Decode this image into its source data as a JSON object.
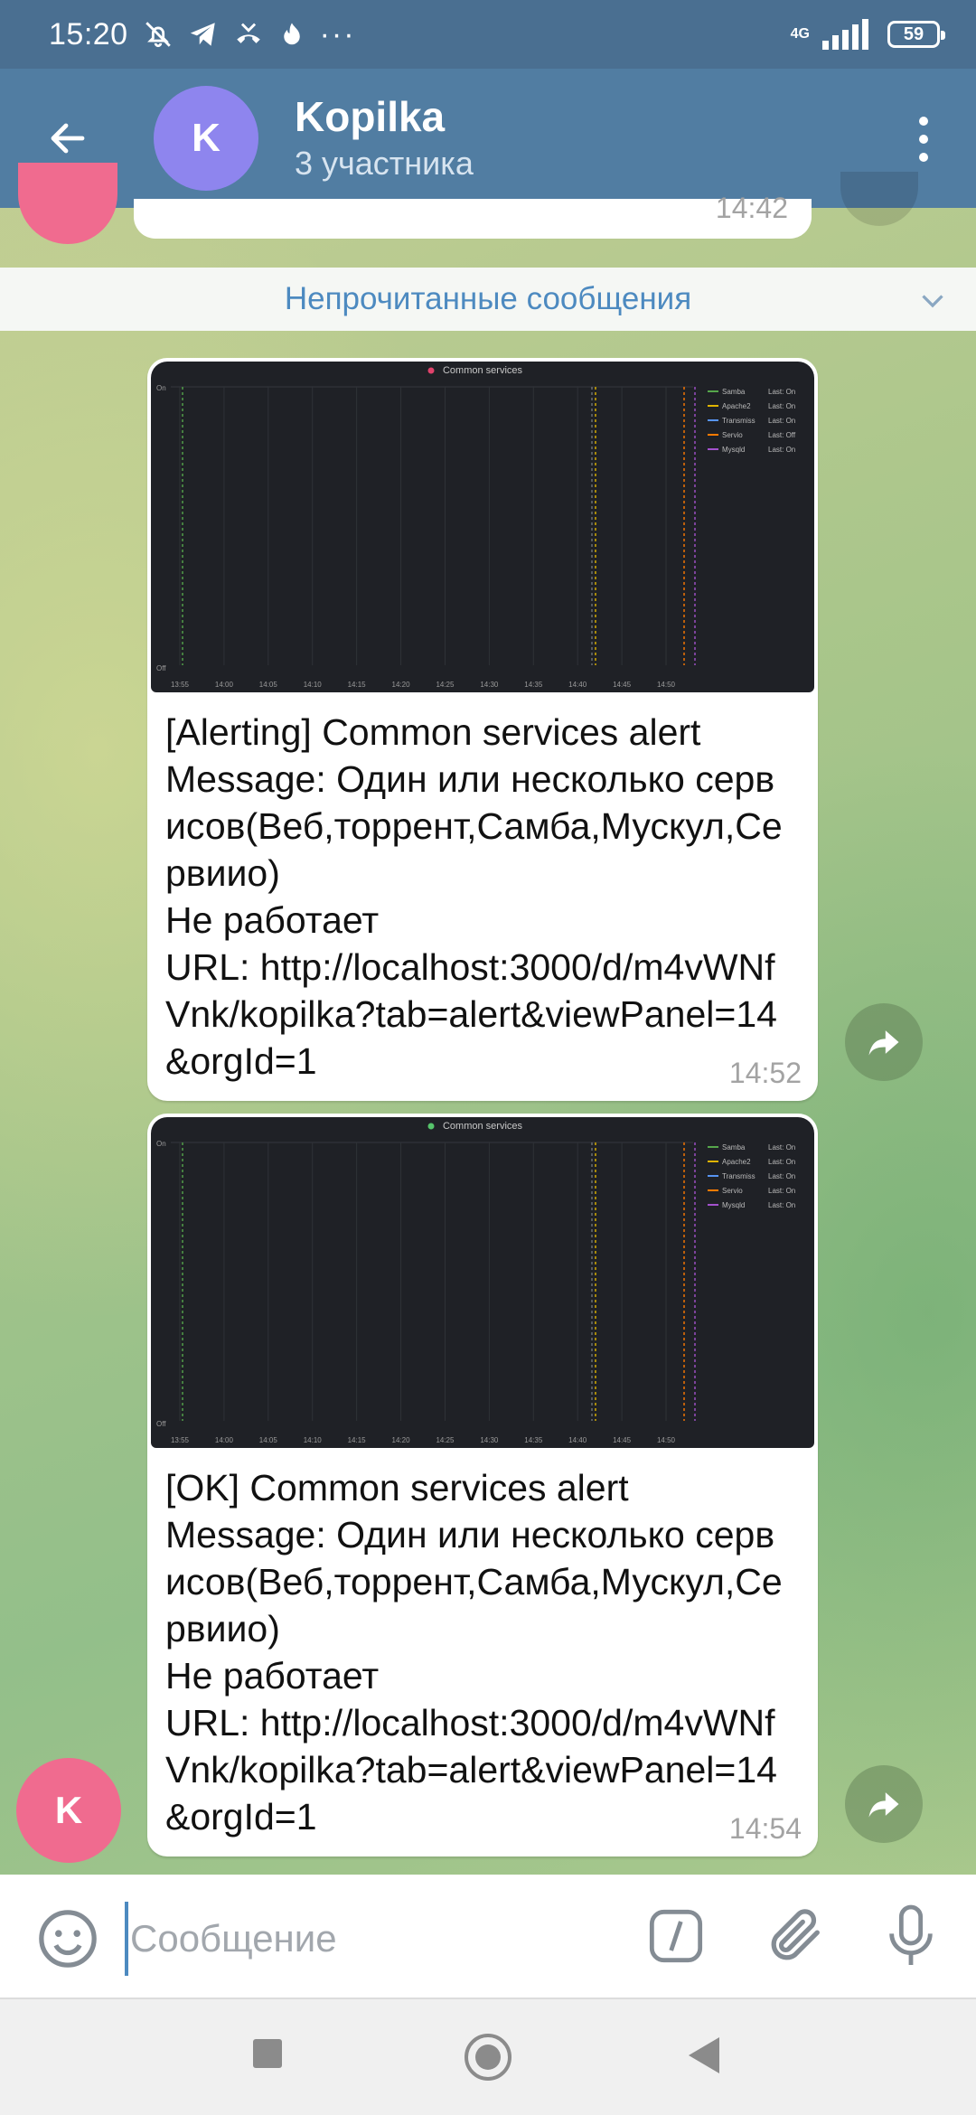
{
  "status_bar": {
    "time": "15:20",
    "network": "4G",
    "battery": "59"
  },
  "header": {
    "back_icon": "arrow-left-icon",
    "avatar_letter": "K",
    "title": "Kopilka",
    "subtitle": "3 участника",
    "menu_icon": "more-vertical-icon"
  },
  "previous_message": {
    "time": "14:42"
  },
  "unread_divider": {
    "label": "Непрочитанные сообщения"
  },
  "messages": [
    {
      "text": "[Alerting] Common services alert\nMessage: Один или несколько сервисов(Веб,торрент,Самба,Мускул,Сервиио)\nНе работает\nURL: http://localhost:3000/d/m4vWNfVnk/kopilka?tab=alert&viewPanel=14&orgId=1",
      "time": "14:52",
      "graph": {
        "title": "Common services",
        "heart_color": "#e0426b",
        "y_ticks": [
          "On",
          "Off"
        ],
        "x_ticks": [
          "13:55",
          "14:00",
          "14:05",
          "14:10",
          "14:15",
          "14:20",
          "14:25",
          "14:30",
          "14:35",
          "14:40",
          "14:45",
          "14:50"
        ],
        "legend": [
          {
            "name": "Samba",
            "value": "Last: On",
            "color": "#56a64b"
          },
          {
            "name": "Apache2",
            "value": "Last: On",
            "color": "#e0b400"
          },
          {
            "name": "Transmiss",
            "value": "Last: On",
            "color": "#5794f2"
          },
          {
            "name": "Servio",
            "value": "Last: Off",
            "color": "#ff7a00"
          },
          {
            "name": "Mysqld",
            "value": "Last: On",
            "color": "#a352cc"
          }
        ]
      }
    },
    {
      "text": "[OK] Common services alert\nMessage: Один или несколько сервисов(Веб,торрент,Самба,Мускул,Сервиио)\nНе работает\nURL: http://localhost:3000/d/m4vWNfVnk/kopilka?tab=alert&viewPanel=14&orgId=1",
      "time": "14:54",
      "sender_avatar_letter": "K",
      "graph": {
        "title": "Common services",
        "heart_color": "#56c46b",
        "y_ticks": [
          "On",
          "Off"
        ],
        "x_ticks": [
          "13:55",
          "14:00",
          "14:05",
          "14:10",
          "14:15",
          "14:20",
          "14:25",
          "14:30",
          "14:35",
          "14:40",
          "14:45",
          "14:50"
        ],
        "legend": [
          {
            "name": "Samba",
            "value": "Last: On",
            "color": "#56a64b"
          },
          {
            "name": "Apache2",
            "value": "Last: On",
            "color": "#e0b400"
          },
          {
            "name": "Transmiss",
            "value": "Last: On",
            "color": "#5794f2"
          },
          {
            "name": "Servio",
            "value": "Last: On",
            "color": "#ff7a00"
          },
          {
            "name": "Mysqld",
            "value": "Last: On",
            "color": "#a352cc"
          }
        ]
      }
    }
  ],
  "input": {
    "placeholder": "Сообщение",
    "value": ""
  },
  "icons": {
    "emoji": "emoji-icon",
    "command": "slash-command-icon",
    "attach": "paperclip-icon",
    "mic": "microphone-icon",
    "share": "forward-icon"
  },
  "nav": {
    "recents": "square-icon",
    "home": "home-circle-icon",
    "back": "triangle-back-icon"
  }
}
